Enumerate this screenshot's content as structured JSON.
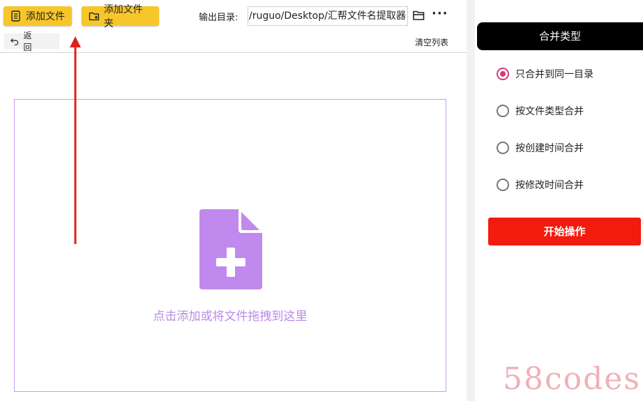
{
  "toolbar": {
    "add_file_label": "添加文件",
    "add_folder_label": "添加文件夹",
    "output_dir_label": "输出目录:",
    "output_dir_value": "/ruguo/Desktop/汇帮文件名提取器",
    "more_label": "···",
    "back_label": "返回",
    "clear_list_label": "清空列表",
    "accent_color": "#f7c62b"
  },
  "drop_zone": {
    "hint": "点击添加或将文件拖拽到这里",
    "icon": "file-plus-icon",
    "color": "#c089ee"
  },
  "annotation": {
    "type": "red-arrow",
    "color": "#e0201b"
  },
  "merge_panel": {
    "header": "合并类型",
    "options": [
      {
        "label": "只合并到同一目录",
        "checked": true
      },
      {
        "label": "按文件类型合并",
        "checked": false
      },
      {
        "label": "按创建时间合并",
        "checked": false
      },
      {
        "label": "按修改时间合并",
        "checked": false
      }
    ],
    "start_label": "开始操作",
    "start_color": "#f31b0d"
  },
  "watermark": "58codes"
}
